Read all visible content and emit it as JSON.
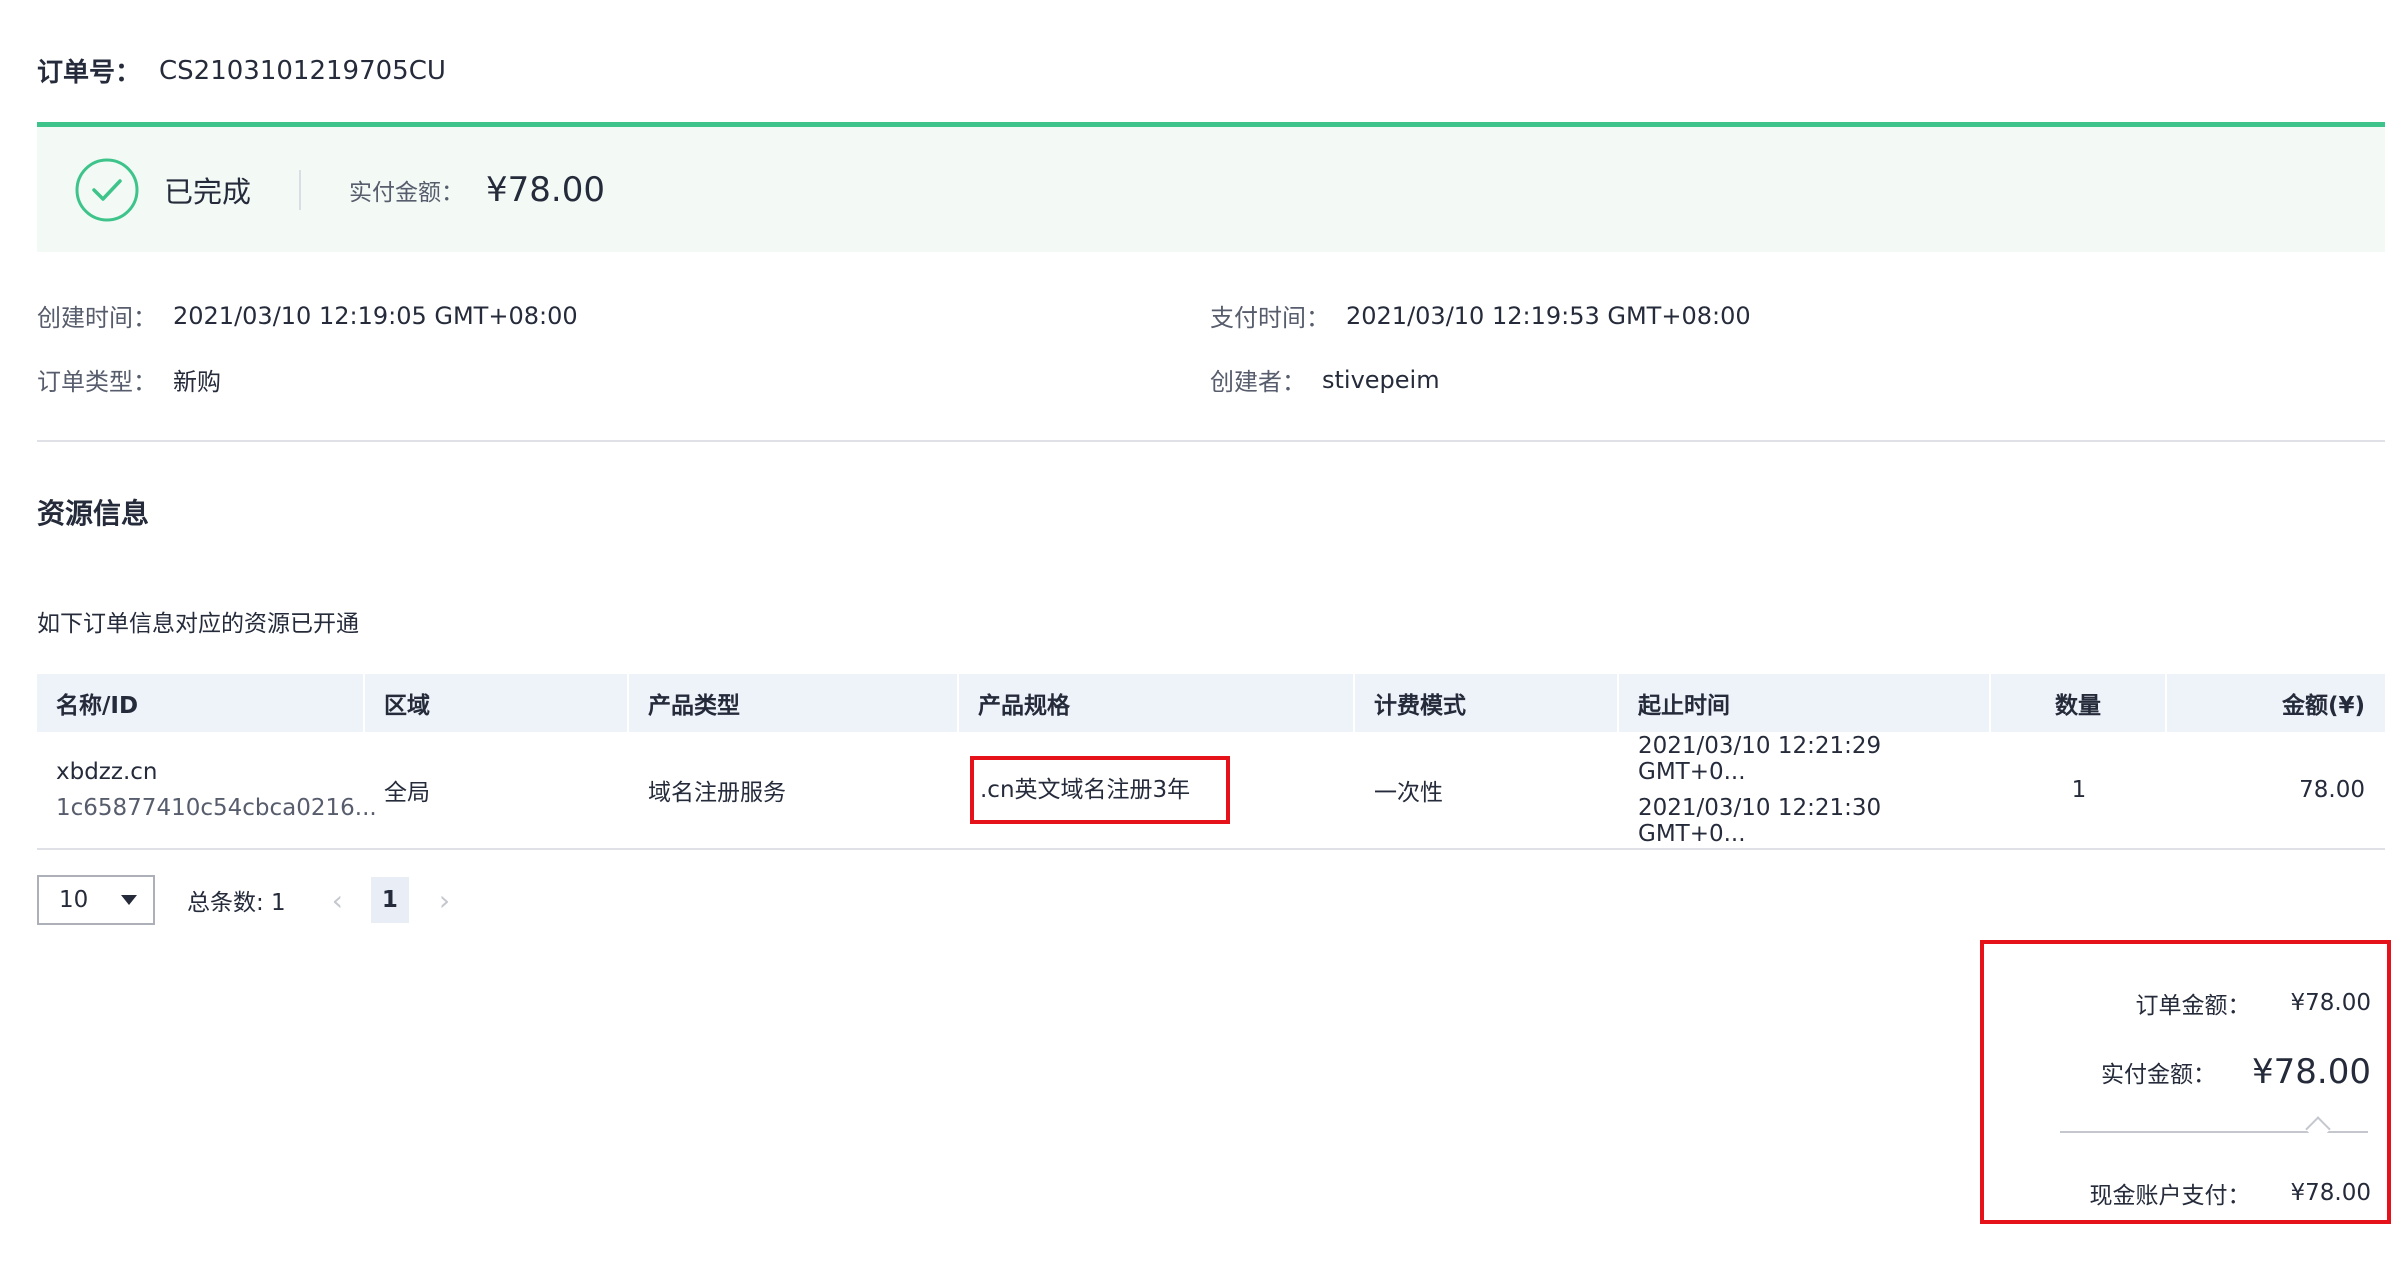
{
  "order": {
    "label": "订单号：",
    "number": "CS2103101219705CU"
  },
  "status": {
    "text": "已完成",
    "paid_label": "实付金额：",
    "paid_value": "¥78.00",
    "accent": "#3ec48a",
    "icon": "check-circle-icon"
  },
  "info": {
    "created_label": "创建时间：",
    "created_value": "2021/03/10 12:19:05 GMT+08:00",
    "paid_time_label": "支付时间：",
    "paid_time_value": "2021/03/10 12:19:53 GMT+08:00",
    "type_label": "订单类型：",
    "type_value": "新购",
    "creator_label": "创建者：",
    "creator_value": "stivepeim"
  },
  "resources": {
    "title": "资源信息",
    "subtitle": "如下订单信息对应的资源已开通",
    "columns": [
      "名称/ID",
      "区域",
      "产品类型",
      "产品规格",
      "计费模式",
      "起止时间",
      "数量",
      "金额(¥)"
    ],
    "row": {
      "name": "xbdzz.cn",
      "id": "1c65877410c54cbca0216...",
      "region": "全局",
      "product_type": "域名注册服务",
      "spec": ".cn英文域名注册3年",
      "billing": "一次性",
      "start": "2021/03/10 12:21:29 GMT+0...",
      "end": "2021/03/10 12:21:30 GMT+0...",
      "quantity": "1",
      "amount": "78.00"
    }
  },
  "pager": {
    "page_size": "10",
    "total": "总条数: 1",
    "current": "1",
    "prev": "‹",
    "next": "›"
  },
  "summary": {
    "order_amount_label": "订单金额：",
    "order_amount": "¥78.00",
    "paid_label": "实付金额：",
    "paid": "¥78.00",
    "cash_label": "现金账户支付：",
    "cash": "¥78.00"
  },
  "highlight_color": "#e5121a"
}
